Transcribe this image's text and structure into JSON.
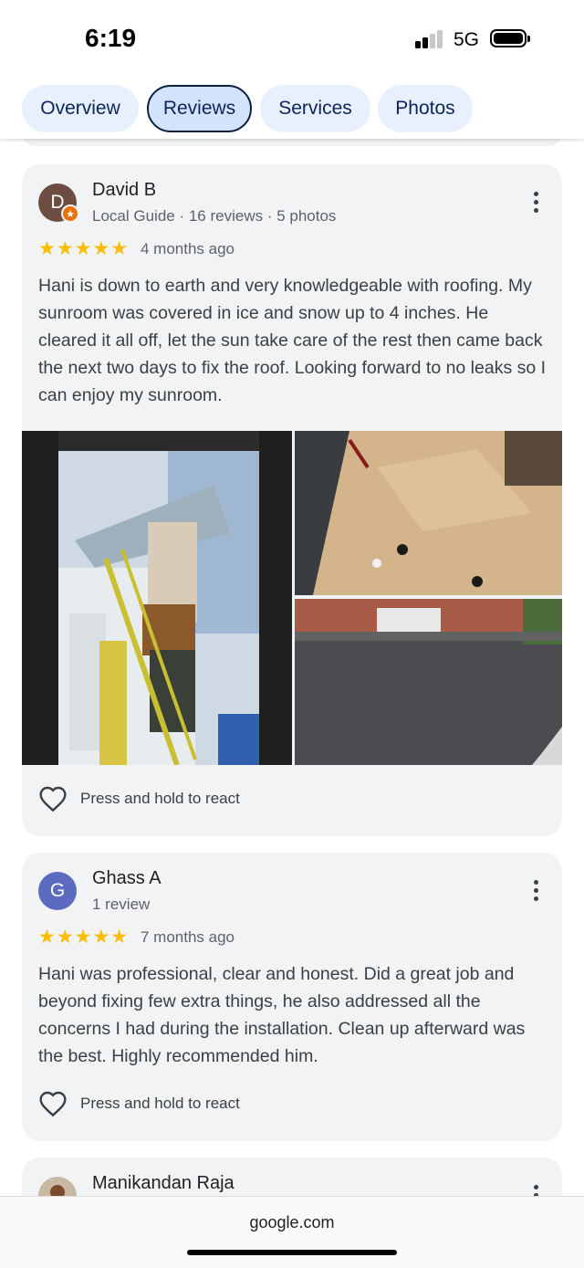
{
  "status": {
    "time": "6:19",
    "network": "5G"
  },
  "tabs": [
    {
      "label": "Overview",
      "active": false
    },
    {
      "label": "Reviews",
      "active": true
    },
    {
      "label": "Services",
      "active": false
    },
    {
      "label": "Photos",
      "active": false
    }
  ],
  "reviews": [
    {
      "initial": "D",
      "avatar_color": "#6d4c41",
      "name": "David B",
      "meta": "Local Guide · 16 reviews · 5 photos",
      "stars": "★★★★★",
      "rating": 5,
      "date": "4 months ago",
      "text": "Hani is down to earth and very knowledgeable with roofing. My sunroom was covered in ice and snow up to 4 inches. He cleared it all off, let the sun take care of the rest then came back the next two days to fix the roof. Looking forward to no leaks so I can enjoy my sunroom.",
      "react_label": "Press and hold to react"
    },
    {
      "initial": "G",
      "avatar_color": "#5c6bc0",
      "name": "Ghass A",
      "meta": "1 review",
      "stars": "★★★★★",
      "rating": 5,
      "date": "7 months ago",
      "text": "Hani was professional, clear and honest. Did a great job and beyond fixing few extra things, he also addressed all the concerns I had during the installation. Clean up afterward was the best. Highly recommended him.",
      "react_label": "Press and hold to react"
    },
    {
      "name": "Manikandan Raja"
    }
  ],
  "browser": {
    "url": "google.com"
  },
  "colors": {
    "star": "#fbbc04",
    "tab_bg": "#e8f0fe",
    "tab_active_bg": "#d3e3fd",
    "card_bg": "#f1f3f4"
  }
}
